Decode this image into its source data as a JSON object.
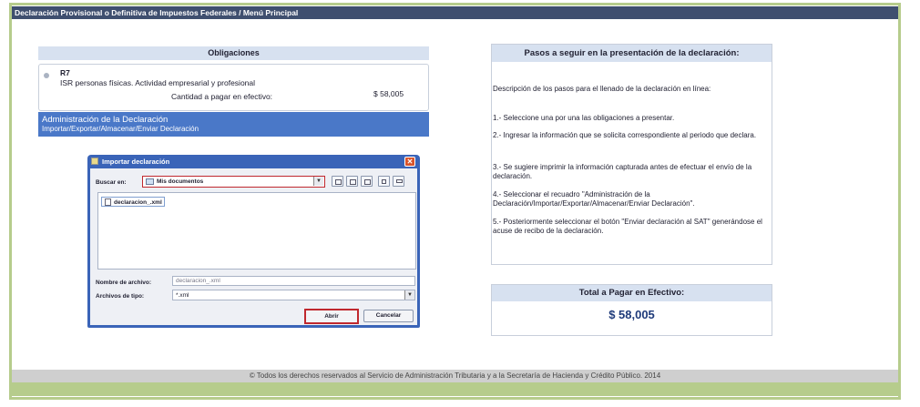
{
  "window": {
    "title": "Declaración Provisional o Definitiva de Impuestos Federales / Menú Principal"
  },
  "obligaciones": {
    "header": "Obligaciones",
    "item": {
      "code": "R7",
      "description": "ISR personas físicas. Actividad empresarial y profesional",
      "amount_label": "Cantidad a pagar en efectivo:",
      "amount": "$ 58,005"
    }
  },
  "admin": {
    "title": "Administración de la Declaración",
    "subtitle": "Importar/Exportar/Almacenar/Enviar Declaración"
  },
  "dialog": {
    "title": "Importar declaración",
    "close_label": "✕",
    "buscar_label": "Buscar en:",
    "buscar_value": "Mis documentos",
    "files": [
      "declaracion_.xml"
    ],
    "nombre_label": "Nombre de archivo:",
    "nombre_value": "declaracion_.xml",
    "tipo_label": "Archivos de tipo:",
    "tipo_value": "*.xml",
    "abrir_label": "Abrir",
    "cancelar_label": "Cancelar"
  },
  "steps": {
    "header": "Pasos a seguir en la presentación de la declaración:",
    "intro": "Descripción de los pasos para el llenado de la declaración en línea:",
    "items": [
      "1.- Seleccione una por una las obligaciones a presentar.",
      "2.- Ingresar la información que se solicita correspondiente al periodo que declara.",
      "3.- Se sugiere imprimir la información capturada antes de efectuar el envío de la declaración.",
      "4.- Seleccionar el recuadro \"Administración de la Declaración/Importar/Exportar/Almacenar/Enviar Declaración\".",
      "5.- Posteriormente seleccionar el botón \"Enviar declaración al SAT\" generándose el acuse de recibo de la declaración."
    ]
  },
  "total": {
    "label": "Total a Pagar en Efectivo:",
    "amount": "$ 58,005"
  },
  "footer": {
    "text": "© Todos los derechos reservados al Servicio de Administración Tributaria y a la Secretaría de Hacienda y Crédito Público. 2014"
  },
  "colors": {
    "frame": "#b6cc8c",
    "titlebar": "#3f4f6f",
    "admin_bar": "#4a78c8",
    "panel_header": "#d7e1f0",
    "dialog_frame": "#3a64b8",
    "highlight": "#c0282e"
  }
}
